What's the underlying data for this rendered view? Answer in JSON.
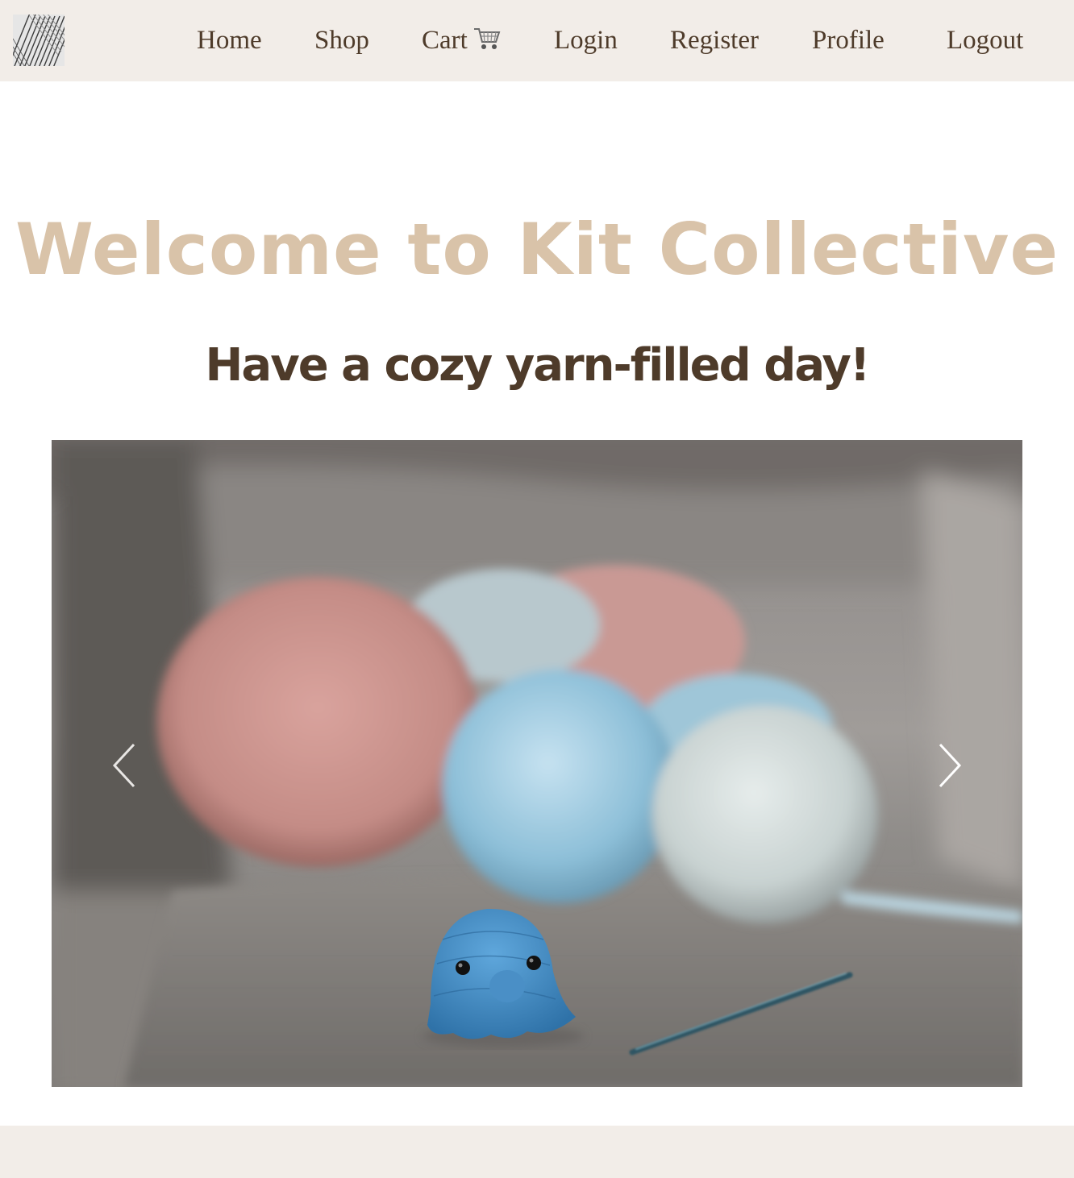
{
  "site": {
    "logo_icon": "yarn-skein-logo"
  },
  "nav": {
    "home": "Home",
    "shop": "Shop",
    "cart": "Cart",
    "cart_icon": "shopping-cart-icon",
    "login": "Login",
    "register": "Register",
    "profile": "Profile",
    "logout": "Logout"
  },
  "hero": {
    "title": "Welcome to Kit Collective",
    "subtitle": "Have a cozy yarn-filled day!"
  },
  "carousel": {
    "prev_icon": "chevron-left-icon",
    "next_icon": "chevron-right-icon"
  },
  "colors": {
    "nav_background": "#f2ede8",
    "nav_text": "#4e3b2a",
    "title": "#d9c3a9",
    "subtitle": "#4e3b2a"
  }
}
